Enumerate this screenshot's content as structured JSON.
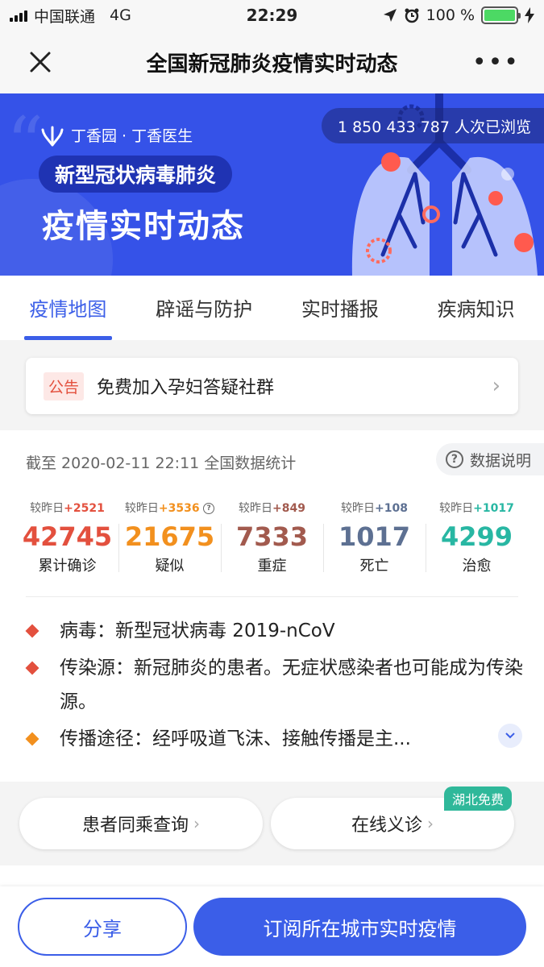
{
  "status_bar": {
    "carrier": "中国联通",
    "network": "4G",
    "time": "22:29",
    "battery": "100 %",
    "icons": [
      "signal-icon",
      "location-icon",
      "alarm-icon",
      "battery-icon",
      "charging-icon"
    ]
  },
  "nav": {
    "title": "全国新冠肺炎疫情实时动态",
    "close_icon": "close-icon",
    "more_icon": "more-icon",
    "more_label": "•••"
  },
  "banner": {
    "brand": "丁香园 · 丁香医生",
    "subtitle": "新型冠状病毒肺炎",
    "title": "疫情实时动态",
    "views": "1 850 433 787 人次已浏览"
  },
  "tabs": [
    {
      "label": "疫情地图",
      "active": true
    },
    {
      "label": "辟谣与防护",
      "active": false
    },
    {
      "label": "实时播报",
      "active": false
    },
    {
      "label": "疾病知识",
      "active": false
    }
  ],
  "notice": {
    "tag": "公告",
    "text": "免费加入孕妇答疑社群",
    "arrow": "›"
  },
  "stats": {
    "timestamp": "截至 2020-02-11 22:11 全国数据统计",
    "explain_label": "数据说明",
    "delta_prefix": "较昨日",
    "metrics": [
      {
        "delta": "+2521",
        "value": "42745",
        "label": "累计确诊",
        "color": "#e3503e"
      },
      {
        "delta": "+3536",
        "value": "21675",
        "label": "疑似",
        "color": "#f2901e"
      },
      {
        "delta": "+849",
        "value": "7333",
        "label": "重症",
        "color": "#a25a4e"
      },
      {
        "delta": "+108",
        "value": "1017",
        "label": "死亡",
        "color": "#5d7092"
      },
      {
        "delta": "+1017",
        "value": "4299",
        "label": "治愈",
        "color": "#28b7a3"
      }
    ]
  },
  "facts": [
    {
      "text": "病毒：新型冠状病毒 2019-nCoV",
      "color": "#e3503e"
    },
    {
      "text": "传染源：新冠肺炎的患者。无症状感染者也可能成为传染源。",
      "color": "#e3503e"
    },
    {
      "text": "传播途径：经呼吸道飞沫、接触传播是主...",
      "color": "#f2901e"
    }
  ],
  "actions": {
    "left": "患者同乘查询",
    "right": "在线义诊",
    "badge": "湖北免费",
    "chevron": "›"
  },
  "bottom": {
    "share": "分享",
    "subscribe": "订阅所在城市实时疫情"
  }
}
